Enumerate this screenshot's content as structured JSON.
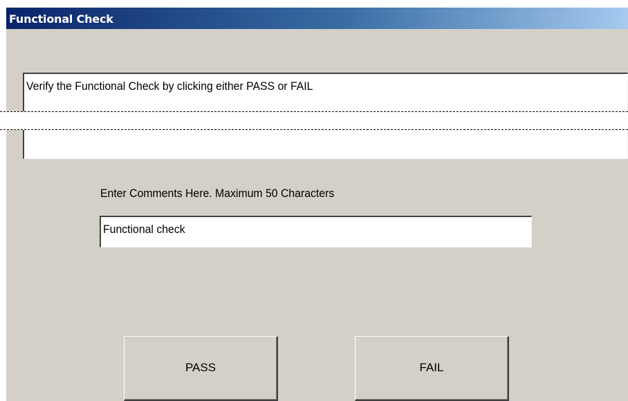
{
  "window": {
    "title": "Functional Check"
  },
  "instruction": {
    "text": "Verify the Functional Check by clicking either PASS or FAIL"
  },
  "comments": {
    "label": "Enter Comments Here. Maximum 50 Characters",
    "value": "Functional check",
    "max_length": 50
  },
  "buttons": {
    "pass_label": "PASS",
    "fail_label": "FAIL"
  },
  "colors": {
    "window_bg": "#d4d0c8",
    "titlebar_start": "#0a246a",
    "titlebar_end": "#a6caf0",
    "field_bg": "#ffffff"
  }
}
